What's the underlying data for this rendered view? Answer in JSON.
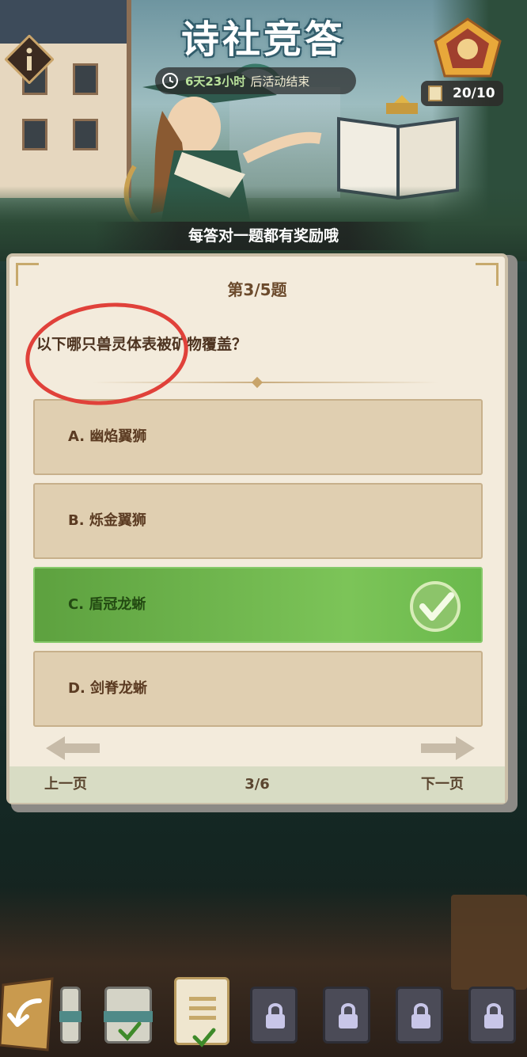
{
  "event": {
    "title": "诗社竞答",
    "timer_days": "6天23小时",
    "timer_suffix": "后活动结束",
    "counter": "20/10",
    "reward_tip": "每答对一题都有奖励哦"
  },
  "quiz": {
    "question_number": "第3/5题",
    "question": "以下哪只兽灵体表被矿物覆盖？",
    "options": [
      {
        "label": "A. 幽焰翼狮",
        "correct": false
      },
      {
        "label": "B. 烁金翼狮",
        "correct": false
      },
      {
        "label": "C. 盾冠龙蜥",
        "correct": true
      },
      {
        "label": "D. 剑脊龙蜥",
        "correct": false
      }
    ]
  },
  "pagination": {
    "prev": "上一页",
    "page": "3/6",
    "next": "下一页"
  },
  "levels": [
    {
      "status": "completed"
    },
    {
      "status": "completed"
    },
    {
      "status": "current"
    },
    {
      "status": "locked"
    },
    {
      "status": "locked"
    },
    {
      "status": "locked"
    },
    {
      "status": "locked"
    }
  ],
  "colors": {
    "correct_green": "#6ab94c",
    "option_tan": "#e0cfb1",
    "card_bg": "#f3ebdc",
    "highlight_red": "#e0413a"
  },
  "icons": [
    "info-icon",
    "clock-icon",
    "trophy-badge-icon",
    "paper-icon",
    "checkmark-icon",
    "arrow-left-icon",
    "arrow-right-icon",
    "back-arrow-icon",
    "lock-icon"
  ]
}
